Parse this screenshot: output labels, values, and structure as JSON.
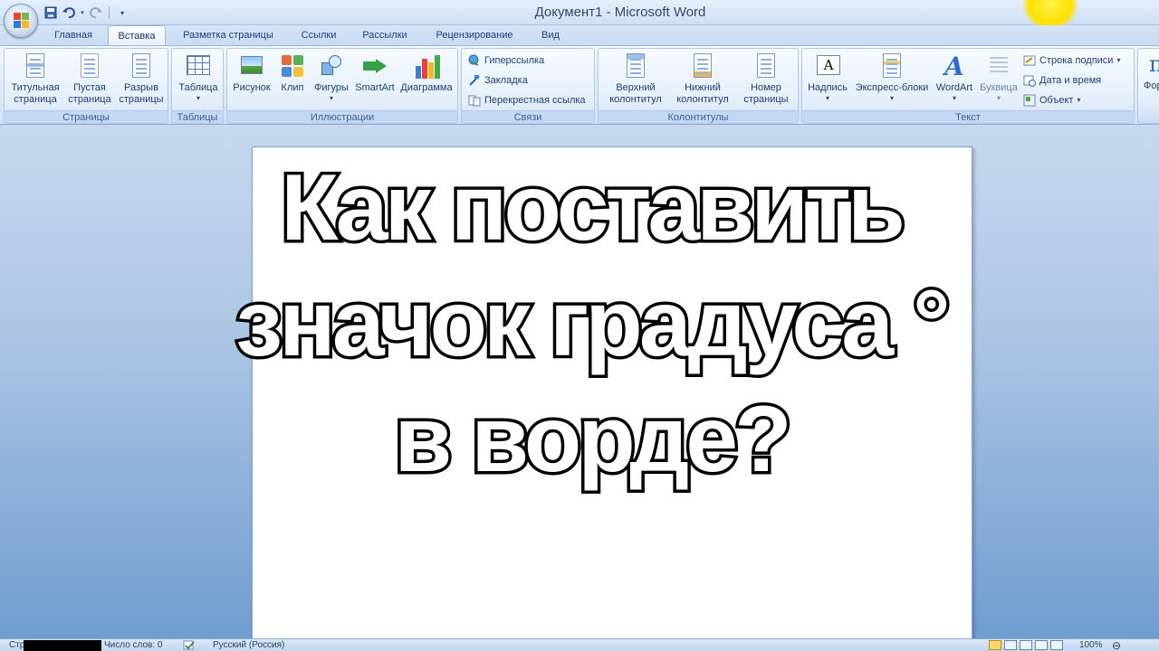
{
  "window": {
    "title": "Документ1 - Microsoft Word"
  },
  "quick_access": {
    "icons": [
      "save-icon",
      "undo-icon",
      "redo-icon",
      "customize-icon"
    ]
  },
  "tabs": [
    {
      "label": "Главная"
    },
    {
      "label": "Вставка"
    },
    {
      "label": "Разметка страницы"
    },
    {
      "label": "Ссылки"
    },
    {
      "label": "Рассылки"
    },
    {
      "label": "Рецензирование"
    },
    {
      "label": "Вид"
    }
  ],
  "active_tab": "Вставка",
  "ribbon": {
    "pages": {
      "label": "Страницы",
      "cover": "Титульная\nстраница",
      "blank": "Пустая\nстраница",
      "break": "Разрыв\nстраницы"
    },
    "tables": {
      "label": "Таблицы",
      "table": "Таблица"
    },
    "illustrations": {
      "label": "Иллюстрации",
      "picture": "Рисунок",
      "clip": "Клип",
      "shapes": "Фигуры",
      "smartart": "SmartArt",
      "chart": "Диаграмма"
    },
    "links": {
      "label": "Связи",
      "hyperlink": "Гиперссылка",
      "bookmark": "Закладка",
      "crossref": "Перекрестная ссылка"
    },
    "header_footer": {
      "label": "Колонтитулы",
      "header": "Верхний\nколонтитул",
      "footer": "Нижний\nколонтитул",
      "page_number": "Номер\nстраницы"
    },
    "text": {
      "label": "Текст",
      "textbox": "Надпись",
      "quickparts": "Экспресс-блоки",
      "wordart": "WordArt",
      "dropcap": "Буквица",
      "signature": "Строка подписи",
      "datetime": "Дата и время",
      "object": "Объект"
    },
    "symbols": {
      "partial": "Фор"
    }
  },
  "headline": {
    "line1": "Как поставить",
    "line2": "значок градуса °",
    "line3": "в ворде?"
  },
  "status": {
    "page_partial": "Стр",
    "words": "Число слов: 0",
    "language": "Русский (Россия)",
    "zoom": "100%"
  },
  "colors": {
    "accent": "#1f3f72",
    "workspace_top": "#c6d9ef",
    "workspace_bottom": "#6f9dd0"
  }
}
